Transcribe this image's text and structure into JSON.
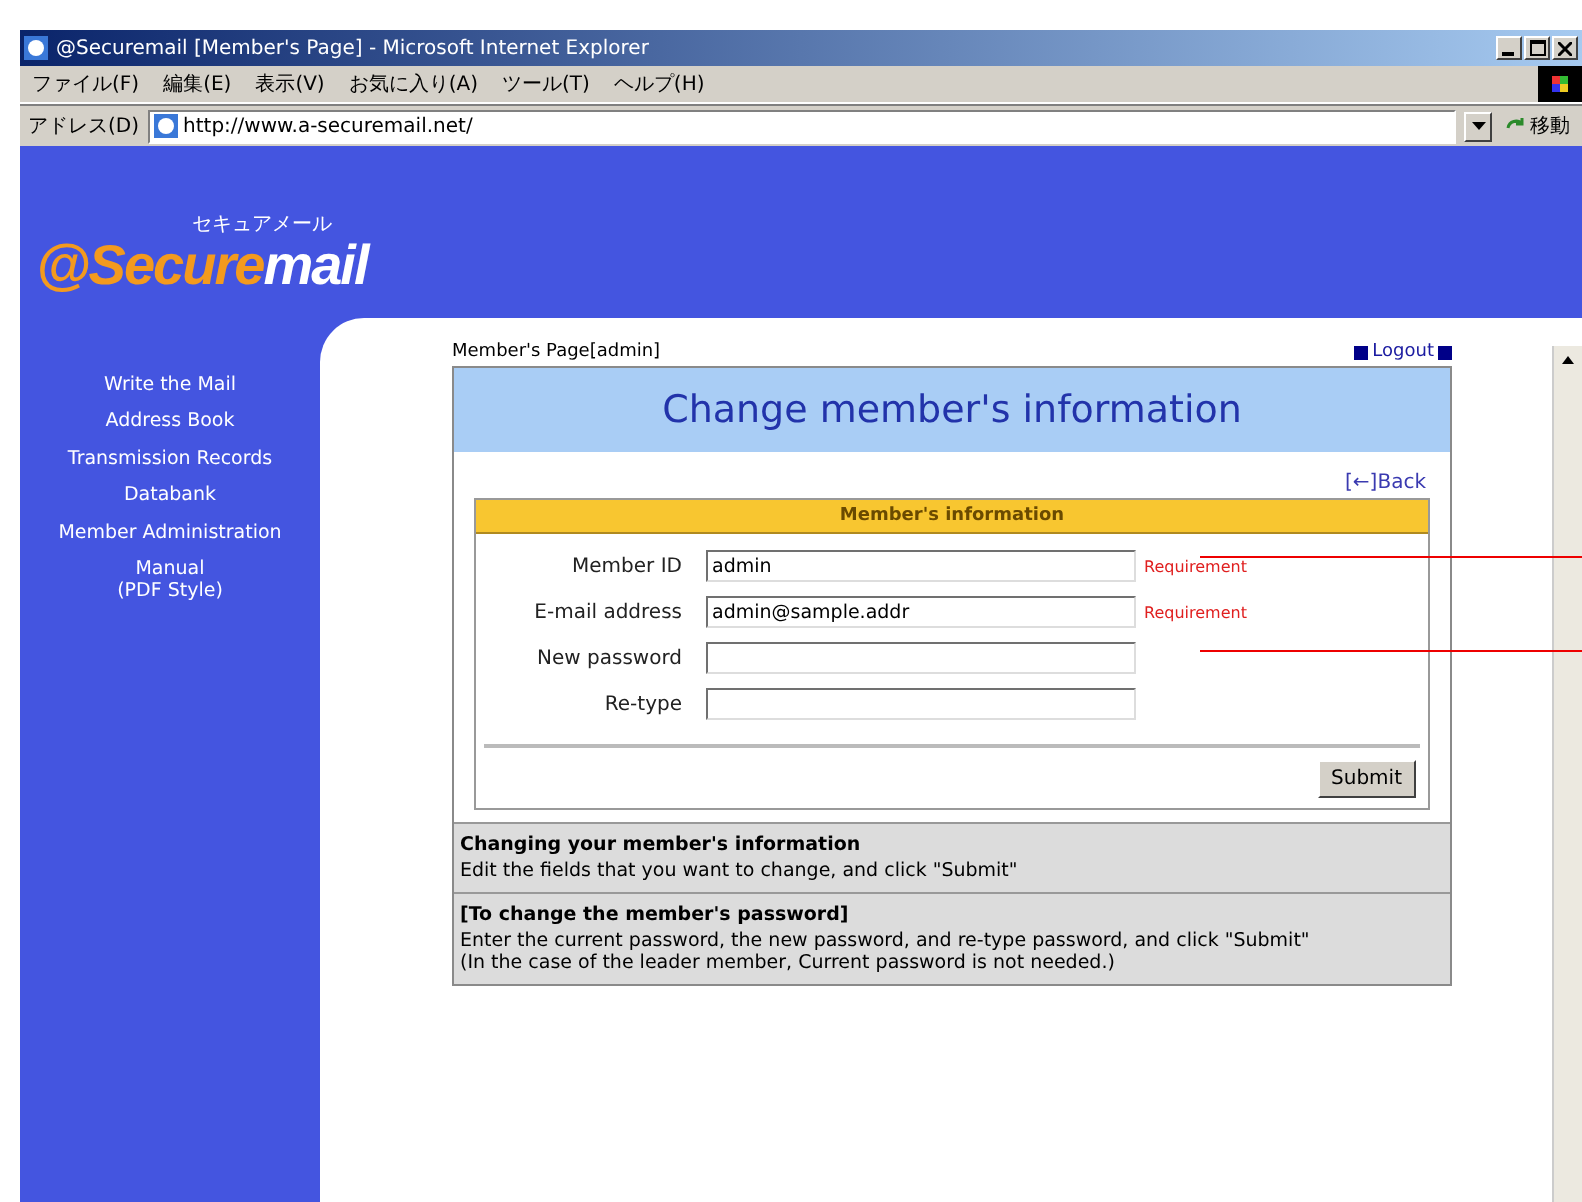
{
  "window": {
    "title": "@Securemail [Member's Page] - Microsoft Internet Explorer"
  },
  "menu": [
    "ファイル(F)",
    "編集(E)",
    "表示(V)",
    "お気に入り(A)",
    "ツール(T)",
    "ヘルプ(H)"
  ],
  "address_bar": {
    "label": "アドレス(D)",
    "value": "http://www.a-securemail.net/",
    "go": "移動"
  },
  "logo": {
    "tagline": "セキュアメール",
    "name_part_1": "@Secure",
    "name_part_2": "mail"
  },
  "sidebar": {
    "items": [
      {
        "label": "Write the Mail"
      },
      {
        "label": "Address Book"
      },
      {
        "label": "Transmission Records"
      },
      {
        "label": "Databank"
      },
      {
        "label": "Member Administration"
      },
      {
        "label": "Manual\n(PDF Style)"
      }
    ]
  },
  "page": {
    "breadcrumb": "Member's Page[admin]",
    "logout": "Logout",
    "title": "Change member's information",
    "back": "[←]Back",
    "form": {
      "heading": "Member's information",
      "fields": [
        {
          "label": "Member ID",
          "value": "admin",
          "note": "Requirement"
        },
        {
          "label": "E-mail address",
          "value": "admin@sample.addr",
          "note": "Requirement"
        },
        {
          "label": "New password"
        },
        {
          "label": "Re-type"
        }
      ],
      "submit": "Submit"
    },
    "help": [
      {
        "heading": "Changing your member's information",
        "text": "Edit the fields that you want to change, and click \"Submit\""
      },
      {
        "heading": "[To change the member's password]",
        "text": "Enter the current password, the new password, and re-type password, and click \"Submit\"\n(In the case of the leader member, Current password is not needed.)"
      }
    ]
  }
}
